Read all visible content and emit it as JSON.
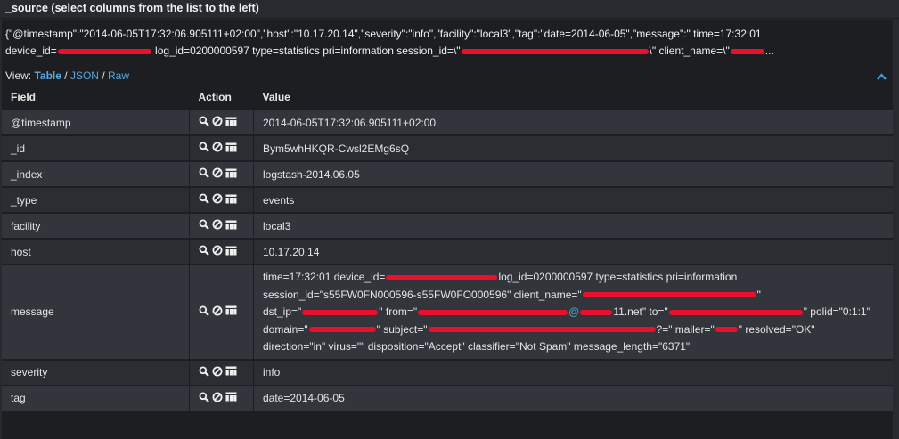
{
  "header": {
    "title": "_source (select columns from the list to the left)"
  },
  "raw": {
    "line1": "{\"@timestamp\":\"2014-06-05T17:32:06.905111+02:00\",\"host\":\"10.17.20.14\",\"severity\":\"info\",\"facility\":\"local3\",\"tag\":\"date=2014-06-05\",\"message\":\" time=17:32:01",
    "line2_a": "device_id=",
    "line2_b": " log_id=0200000597 type=statistics pri=information session_id=\\\"",
    "line2_c": "\\\" client_name=\\\"",
    "line2_d": "..."
  },
  "view": {
    "label": "View:",
    "table": "Table",
    "json": "JSON",
    "raw": "Raw",
    "sep": "/"
  },
  "columns": {
    "field": "Field",
    "action": "Action",
    "value": "Value"
  },
  "rows": [
    {
      "field": "@timestamp",
      "value": "2014-06-05T17:32:06.905111+02:00"
    },
    {
      "field": "_id",
      "value": "Bym5whHKQR-Cwsl2EMg6sQ"
    },
    {
      "field": "_index",
      "value": "logstash-2014.06.05"
    },
    {
      "field": "_type",
      "value": "events"
    },
    {
      "field": "facility",
      "value": "local3"
    },
    {
      "field": "host",
      "value": "10.17.20.14"
    },
    {
      "field": "message"
    },
    {
      "field": "severity",
      "value": "info"
    },
    {
      "field": "tag",
      "value": "date=2014-06-05"
    }
  ],
  "message": {
    "l1_a": " time=17:32:01 device_id=",
    "l1_b": "log_id=0200000597 type=statistics pri=information",
    "l2_a": "session_id=\"s55FW0FN000596-s55FW0FO000596\" client_name=\"",
    "l2_b": "\"",
    "l3_a": "dst_ip=\"",
    "l3_b": "\" from=\"",
    "l3_at": "@",
    "l3_c": "11.net\" to=\"",
    "l3_d": "\" polid=\"0:1:1\"",
    "l4_a": "domain=\"",
    "l4_b": "\" subject=\"",
    "l4_c": "?=\" mailer=\"",
    "l4_d": "\" resolved=\"OK\"",
    "l5": "direction=\"in\" virus=\"\" disposition=\"Accept\" classifier=\"Not Spam\" message_length=\"6371\""
  },
  "icons": [
    "magnifier-icon",
    "ban-icon",
    "columns-icon",
    "chevron-up-icon"
  ],
  "colors": {
    "background": "#272b30",
    "panel": "#1c1e22",
    "link": "#5aa8e0",
    "redaction": "#e8102a"
  }
}
